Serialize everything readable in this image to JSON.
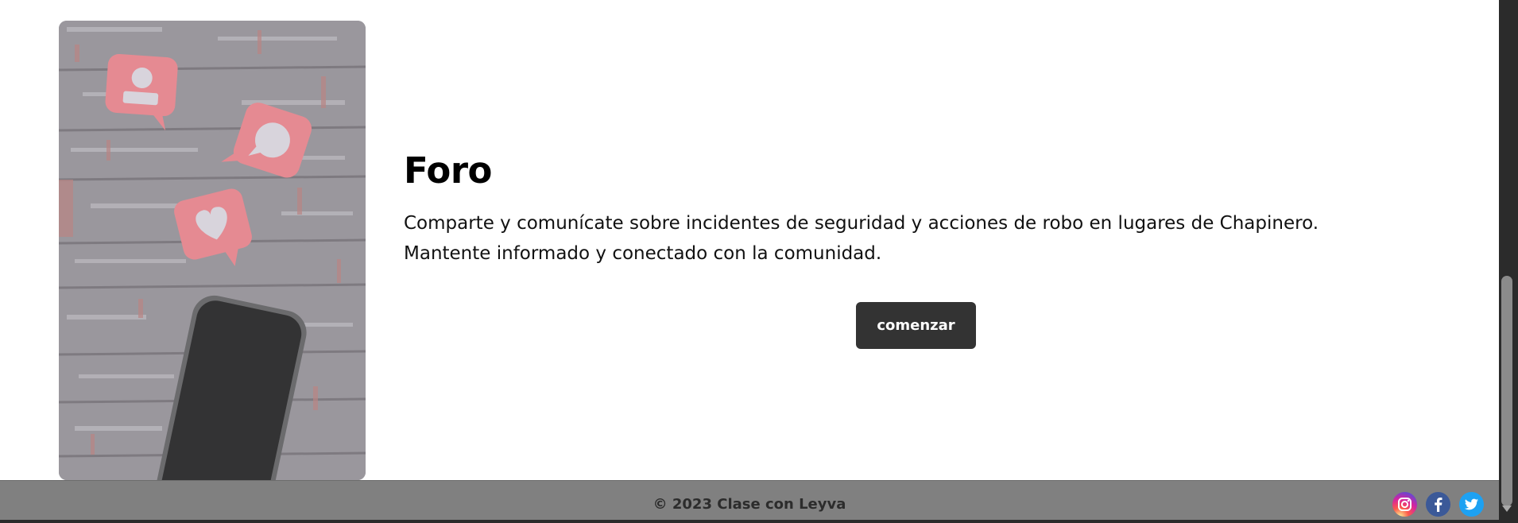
{
  "section": {
    "title": "Foro",
    "description": "Comparte y comunícate sobre incidentes de seguridad y acciones de robo en lugares de Chapinero. Mantente informado y conectado con la comunidad.",
    "cta_label": "comenzar"
  },
  "footer": {
    "copyright": "© 2023 Clase con Leyva",
    "social": [
      {
        "name": "instagram-icon",
        "color": "#d6249f"
      },
      {
        "name": "facebook-icon",
        "color": "#3b5998"
      },
      {
        "name": "twitter-icon",
        "color": "#1da1f2"
      }
    ]
  },
  "colors": {
    "button_bg": "#333333",
    "footer_bg": "#808080",
    "bubble_pink": "#e58a92"
  }
}
